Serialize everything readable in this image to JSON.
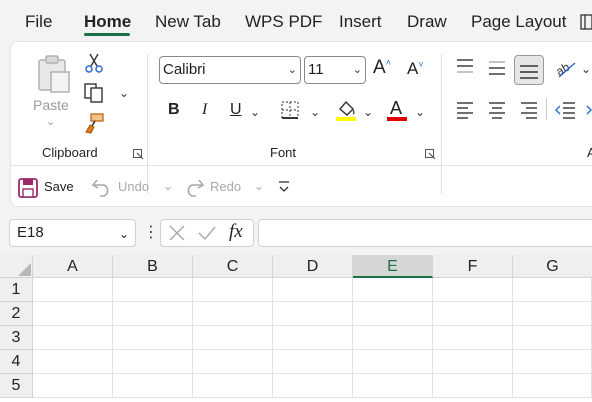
{
  "menu": {
    "tabs": [
      {
        "label": "File"
      },
      {
        "label": "Home"
      },
      {
        "label": "New Tab"
      },
      {
        "label": "WPS PDF"
      },
      {
        "label": "Insert"
      },
      {
        "label": "Draw"
      },
      {
        "label": "Page Layout"
      }
    ],
    "active_tab": "Home"
  },
  "ribbon": {
    "clipboard": {
      "paste_label": "Paste",
      "group_label": "Clipboard"
    },
    "font": {
      "font_name": "Calibri",
      "font_size": "11",
      "bold": "B",
      "italic": "I",
      "underline": "U",
      "group_label": "Font",
      "highlight_color": "#ffff00",
      "font_color": "#e00000"
    },
    "alignment": {
      "group_label_partial": "A"
    }
  },
  "qat": {
    "save_label": "Save",
    "undo_label": "Undo",
    "redo_label": "Redo"
  },
  "formula_bar": {
    "name_box": "E18",
    "fx_label": "fx",
    "formula": ""
  },
  "grid": {
    "columns": [
      "A",
      "B",
      "C",
      "D",
      "E",
      "F",
      "G"
    ],
    "rows": [
      "1",
      "2",
      "3",
      "4",
      "5"
    ],
    "selected_column": "E",
    "accent": "#1e7145"
  }
}
